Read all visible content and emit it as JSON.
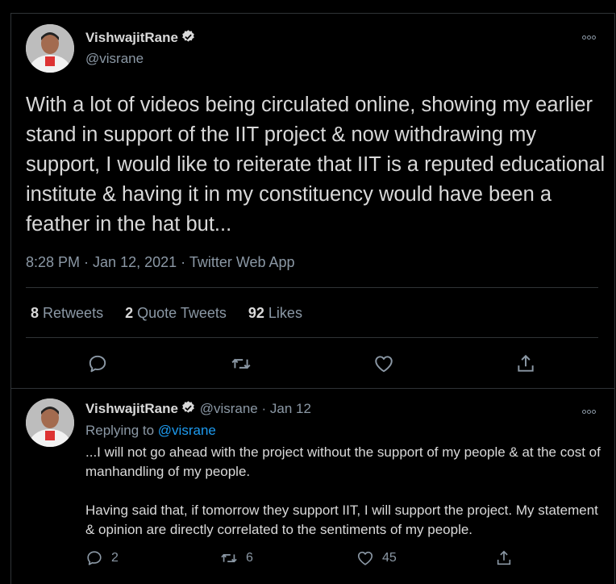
{
  "tweet": {
    "display_name": "VishwajitRane",
    "handle": "@visrane",
    "more_icon": "ellipsis-icon",
    "text": "With a lot of videos being circulated online, showing my earlier stand in support of the IIT project & now withdrawing my support, I would like to reiterate that IIT is a reputed educational institute & having it in my constituency would have been a feather in the hat but...",
    "time": "8:28 PM",
    "date": "Jan 12, 2021",
    "source": "Twitter Web App",
    "retweets_count": "8",
    "retweets_label": "Retweets",
    "quotes_count": "2",
    "quotes_label": "Quote Tweets",
    "likes_count": "92",
    "likes_label": "Likes"
  },
  "reply": {
    "display_name": "VishwajitRane",
    "handle": "@visrane",
    "date": "Jan 12",
    "replying_prefix": "Replying to",
    "replying_to": "@visrane",
    "paragraph1": "...I will not go ahead with the project without the support of my people & at the cost of manhandling of my people.",
    "paragraph2": "Having said that, if tomorrow they support IIT, I will support the project. My statement & opinion are directly correlated to the sentiments of my people.",
    "reply_count": "2",
    "retweet_count": "6",
    "like_count": "45"
  },
  "colors": {
    "background": "#000000",
    "text": "#d9d9d9",
    "muted": "#8b98a5",
    "link": "#1d9bf0",
    "verified": "#d9d9d9"
  }
}
